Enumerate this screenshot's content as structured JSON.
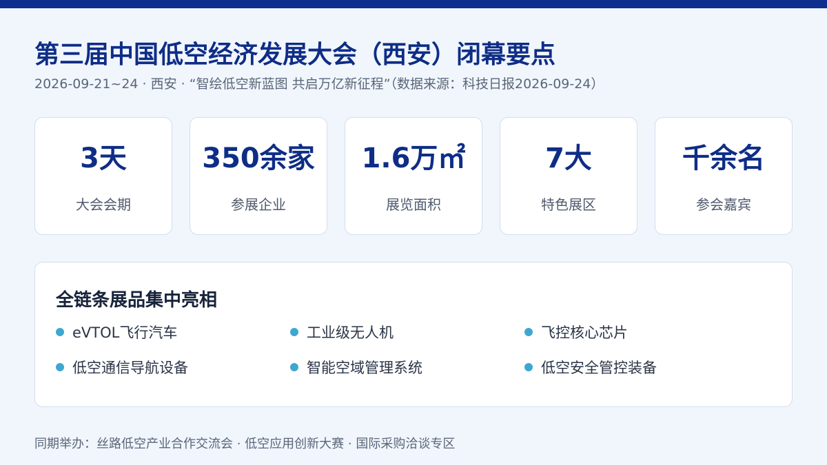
{
  "title": "第三届中国低空经济发展大会（西安）闭幕要点",
  "subtitle": "2026-09-21~24 · 西安 · “智绘低空新蓝图 共启万亿新征程”（数据来源：科技日报2026-09-24）",
  "stats": [
    {
      "value": "3天",
      "label": "大会会期"
    },
    {
      "value": "350余家",
      "label": "参展企业"
    },
    {
      "value": "1.6万㎡",
      "label": "展览面积"
    },
    {
      "value": "7大",
      "label": "特色展区"
    },
    {
      "value": "千余名",
      "label": "参会嘉宾"
    }
  ],
  "exhibits": {
    "heading": "全链条展品集中亮相",
    "items": [
      "eVTOL飞行汽车",
      "工业级无人机",
      "飞控核心芯片",
      "低空通信导航设备",
      "智能空域管理系统",
      "低空安全管控装备"
    ]
  },
  "footer": "同期举办：丝路低空产业合作交流会 · 低空应用创新大赛 · 国际采购洽谈专区",
  "colors": {
    "accent": "#0e2d86",
    "top_bar": "#0f2f8f",
    "bullet": "#3ea7d0",
    "background": "#f1f6fd"
  }
}
